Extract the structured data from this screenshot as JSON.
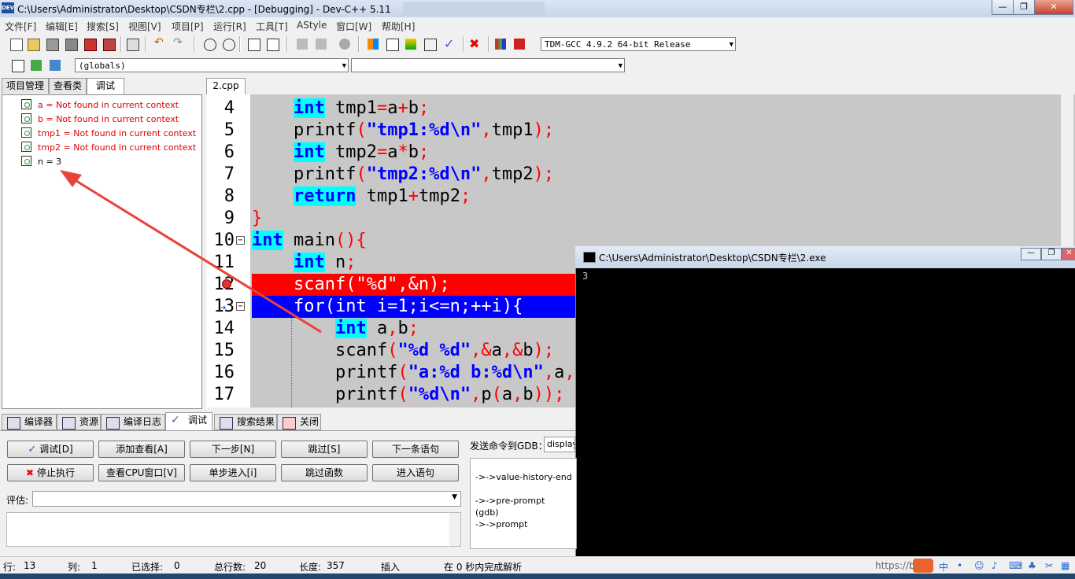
{
  "window": {
    "title": "C:\\Users\\Administrator\\Desktop\\CSDN专栏\\2.cpp - [Debugging] - Dev-C++ 5.11",
    "app_icon": "DEV"
  },
  "menu": [
    "文件[F]",
    "编辑[E]",
    "搜索[S]",
    "视图[V]",
    "项目[P]",
    "运行[R]",
    "工具[T]",
    "AStyle",
    "窗口[W]",
    "帮助[H]"
  ],
  "toolbar": {
    "compiler": "TDM-GCC 4.9.2 64-bit Release",
    "scope": "(globals)",
    "member": ""
  },
  "left_tabs": [
    "项目管理",
    "查看类",
    "调试"
  ],
  "watches": [
    {
      "text": "a = Not found in current context",
      "error": true
    },
    {
      "text": "b = Not found in current context",
      "error": true
    },
    {
      "text": "tmp1 = Not found in current context",
      "error": true
    },
    {
      "text": "tmp2 = Not found in current context",
      "error": true
    },
    {
      "text": "n = 3",
      "error": false
    }
  ],
  "editor": {
    "file_tab": "2.cpp",
    "lines": [
      {
        "n": "4"
      },
      {
        "n": "5"
      },
      {
        "n": "6"
      },
      {
        "n": "7"
      },
      {
        "n": "8"
      },
      {
        "n": "9"
      },
      {
        "n": "10"
      },
      {
        "n": "11"
      },
      {
        "n": "12"
      },
      {
        "n": "13"
      },
      {
        "n": "14"
      },
      {
        "n": "15"
      },
      {
        "n": "16"
      },
      {
        "n": "17"
      }
    ]
  },
  "console": {
    "title": "C:\\Users\\Administrator\\Desktop\\CSDN专栏\\2.exe",
    "output": "3"
  },
  "bottom_tabs": [
    "编译器",
    "资源",
    "编译日志",
    "调试",
    "搜索结果",
    "关闭"
  ],
  "debug": {
    "buttons_row1": [
      "调试[D]",
      "添加查看[A]",
      "下一步[N]",
      "跳过[S]",
      "下一条语句"
    ],
    "buttons_row2": [
      "停止执行",
      "查看CPU窗口[V]",
      "单步进入[i]",
      "跳过函数",
      "进入语句"
    ],
    "gdb_label": "发送命令到GDB：",
    "gdb_value": "display",
    "eval_label": "评估:",
    "gdb_output": [
      "->->value-history-end",
      "->->pre-prompt",
      "(gdb)",
      "->->prompt"
    ]
  },
  "status": {
    "row_label": "行:",
    "row": "13",
    "col_label": "列:",
    "col": "1",
    "sel_label": "已选择:",
    "sel": "0",
    "total_label": "总行数:",
    "total": "20",
    "len_label": "长度:",
    "len": "357",
    "mode": "插入",
    "parse": "在 0 秒内完成解析"
  },
  "tray": {
    "url_fragment": "https://bl",
    "ime": "中"
  },
  "colors": {
    "keyword_bg": "#00ffff",
    "breakpoint": "#ff0000",
    "exec_line": "#0000ff",
    "error_text": "#e00000",
    "annotation_arrow": "#e8433a"
  }
}
